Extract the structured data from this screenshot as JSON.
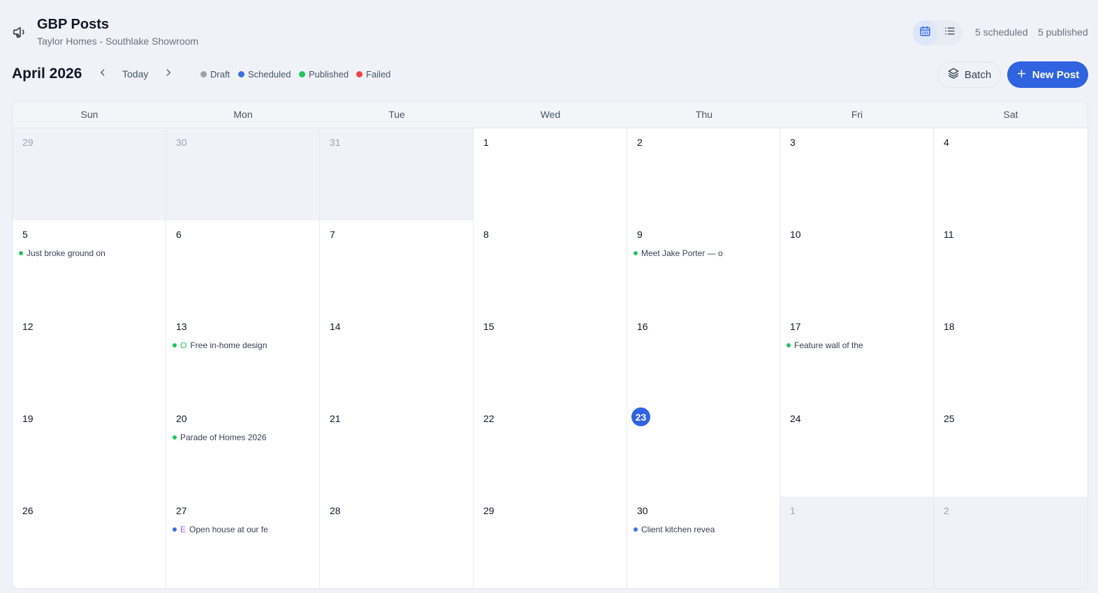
{
  "header": {
    "title": "GBP Posts",
    "subtitle": "Taylor Homes - Southlake Showroom",
    "icon": "megaphone-icon",
    "scheduled_count": "5 scheduled",
    "published_count": "5 published",
    "view_toggle": {
      "active": "calendar-icon",
      "inactive": "list-icon"
    }
  },
  "toolbar": {
    "month_label": "April 2026",
    "today_label": "Today",
    "legend": [
      {
        "label": "Draft",
        "color": "#9ca3af"
      },
      {
        "label": "Scheduled",
        "color": "#3b6fe5"
      },
      {
        "label": "Published",
        "color": "#22c55e"
      },
      {
        "label": "Failed",
        "color": "#ef4444"
      }
    ],
    "batch_label": "Batch",
    "new_post_label": "New Post"
  },
  "colors": {
    "accent": "#2f63e0",
    "published": "#22c55e",
    "scheduled": "#3b6fe5",
    "badge_published": "#22c55e",
    "badge_scheduled": "#a855f7"
  },
  "calendar": {
    "weekdays": [
      "Sun",
      "Mon",
      "Tue",
      "Wed",
      "Thu",
      "Fri",
      "Sat"
    ],
    "today": "23",
    "weeks": [
      [
        {
          "day": "29",
          "other": true
        },
        {
          "day": "30",
          "other": true
        },
        {
          "day": "31",
          "other": true
        },
        {
          "day": "1"
        },
        {
          "day": "2"
        },
        {
          "day": "3"
        },
        {
          "day": "4"
        }
      ],
      [
        {
          "day": "5",
          "post": {
            "text": "Just broke ground on",
            "status": "published"
          }
        },
        {
          "day": "6"
        },
        {
          "day": "7"
        },
        {
          "day": "8"
        },
        {
          "day": "9",
          "post": {
            "text": "Meet Jake Porter — o",
            "status": "published"
          }
        },
        {
          "day": "10"
        },
        {
          "day": "11"
        }
      ],
      [
        {
          "day": "12"
        },
        {
          "day": "13",
          "post": {
            "text": "Free in-home design",
            "status": "published",
            "badge": "O"
          }
        },
        {
          "day": "14"
        },
        {
          "day": "15"
        },
        {
          "day": "16"
        },
        {
          "day": "17",
          "post": {
            "text": "Feature wall of the",
            "status": "published"
          }
        },
        {
          "day": "18"
        }
      ],
      [
        {
          "day": "19"
        },
        {
          "day": "20",
          "post": {
            "text": "Parade of Homes 2026",
            "status": "published"
          }
        },
        {
          "day": "21"
        },
        {
          "day": "22"
        },
        {
          "day": "23",
          "today": true
        },
        {
          "day": "24"
        },
        {
          "day": "25"
        }
      ],
      [
        {
          "day": "26"
        },
        {
          "day": "27",
          "post": {
            "text": "Open house at our fe",
            "status": "scheduled",
            "badge": "E"
          }
        },
        {
          "day": "28"
        },
        {
          "day": "29"
        },
        {
          "day": "30",
          "post": {
            "text": "Client kitchen revea",
            "status": "scheduled"
          }
        },
        {
          "day": "1",
          "other": true
        },
        {
          "day": "2",
          "other": true
        }
      ]
    ]
  }
}
